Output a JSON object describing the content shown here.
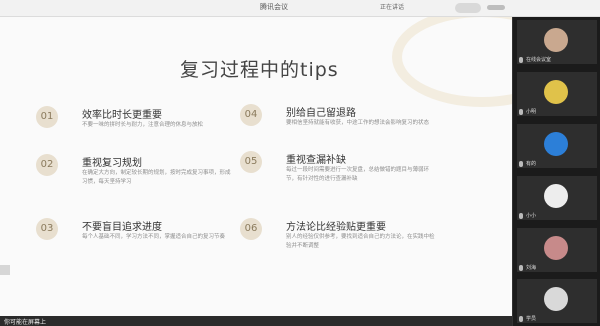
{
  "window": {
    "title": "腾讯会议",
    "presenter": "正在讲话"
  },
  "slide": {
    "title": "复习过程中的tips",
    "items": [
      {
        "num": "01",
        "heading": "效率比时长更重要",
        "desc": "不要一味的拼时长与耐力，注意合理的休息与放松"
      },
      {
        "num": "02",
        "heading": "重视复习规划",
        "desc": "在确定大方向，制定较长期的规划，按时完成复习事项，形成习惯，每天坚持学习"
      },
      {
        "num": "03",
        "heading": "不要盲目追求进度",
        "desc": "每个人基础不同，学习方法不同，掌握适合自己的复习节奏"
      },
      {
        "num": "04",
        "heading": "别给自己留退路",
        "desc": "要相信坚持就能有收获，中途工作的想法会影响复习的状态"
      },
      {
        "num": "05",
        "heading": "重视查漏补缺",
        "desc": "每过一段时间需要进行一次复盘，总结做错的题目与薄弱环节，有针对性的进行查漏补缺"
      },
      {
        "num": "06",
        "heading": "方法论比经验贴更重要",
        "desc": "别人的经验仅供参考，要找到适合自己的方法论，在实践中检验并不断调整"
      }
    ]
  },
  "bottom_bar": {
    "text": "你可能在屏幕上"
  },
  "participants": [
    {
      "name": "在线会议室",
      "color": "#c9a88f"
    },
    {
      "name": "小明",
      "color": "#e0c24a"
    },
    {
      "name": "有的",
      "color": "#2c7fd8"
    },
    {
      "name": "小小",
      "color": "#ededed"
    },
    {
      "name": "刘海",
      "color": "#c78a8a"
    },
    {
      "name": "学员",
      "color": "#d9d9d9"
    }
  ],
  "colors": {
    "badge_bg": "#e8dfcf",
    "badge_text": "#8a7a5c",
    "sidebar_bg": "#1b1b1b"
  }
}
